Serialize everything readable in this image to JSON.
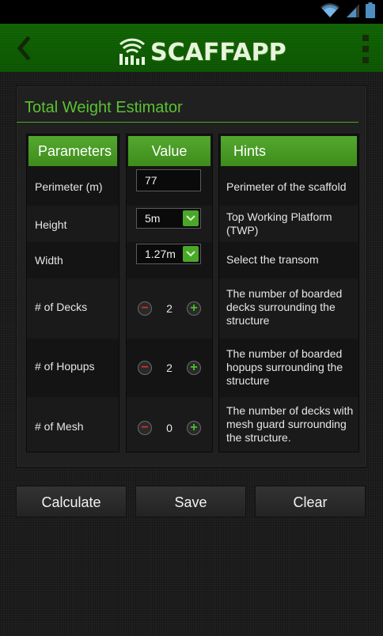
{
  "app": {
    "title": "SCAFFAPP"
  },
  "panel": {
    "title": "Total Weight Estimator"
  },
  "headers": {
    "parameters": "Parameters",
    "value": "Value",
    "hints": "Hints"
  },
  "rows": [
    {
      "label": "Perimeter (m)",
      "value": "77",
      "hint": "Perimeter of the scaffold"
    },
    {
      "label": "Height",
      "value": "5m",
      "hint": "Top Working Platform (TWP)"
    },
    {
      "label": "Width",
      "value": "1.27m",
      "hint": "Select the transom"
    },
    {
      "label": "# of Decks",
      "value": "2",
      "hint": "The number of boarded decks surrounding the structure"
    },
    {
      "label": "# of Hopups",
      "value": "2",
      "hint": "The number of boarded hopups surrounding the structure"
    },
    {
      "label": "# of Mesh",
      "value": "0",
      "hint": "The number of decks with mesh guard surrounding the structure."
    }
  ],
  "buttons": {
    "calculate": "Calculate",
    "save": "Save",
    "clear": "Clear"
  },
  "colors": {
    "accent": "#4aa829",
    "title_green": "#5bc232",
    "minus": "#e02a2a",
    "plus": "#4ac02a"
  }
}
